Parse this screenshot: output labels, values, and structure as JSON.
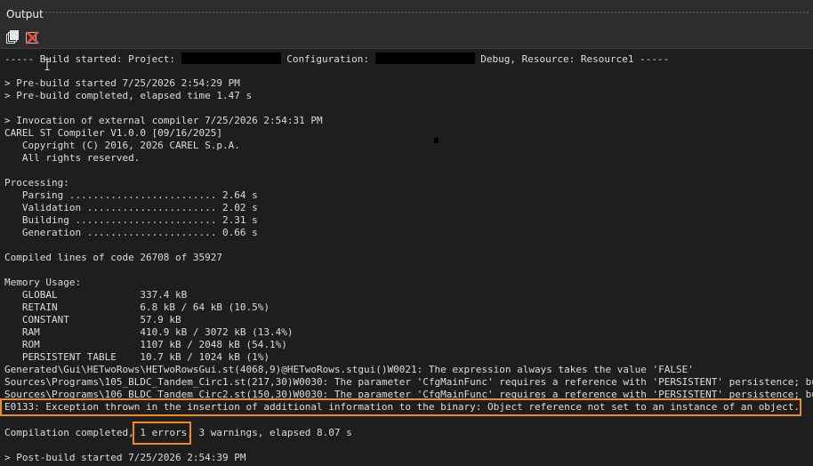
{
  "window": {
    "title": "Output"
  },
  "toolbar": {
    "buttons": [
      {
        "icon": "copy-icon",
        "tooltip": ""
      },
      {
        "icon": "clear-icon",
        "tooltip": ""
      }
    ]
  },
  "output": {
    "header_start": "----- Build started: Project: ",
    "header_config": " Configuration: ",
    "header_end": " Debug, Resource: Resource1 -----",
    "lines": [
      "> Pre-build started 7/25/2026 2:54:29 PM",
      "> Pre-build completed, elapsed time 1.47 s",
      "> Invocation of external compiler 7/25/2026 2:54:31 PM",
      "CAREL ST Compiler V1.0.0 [09/16/2025]",
      "   Copyright (C) 2016, 2026 CAREL S.p.A.",
      "   All rights reserved.",
      "Processing:",
      "   Parsing ......................... 2.64 s",
      "   Validation ...................... 2.02 s",
      "   Building ........................ 2.31 s",
      "   Generation ...................... 0.66 s",
      "Compiled lines of code 26708 of 35927",
      "Memory Usage:",
      "   GLOBAL              337.4 kB",
      "   RETAIN              6.8 kB / 64 kB (10.5%)",
      "   CONSTANT            57.9 kB",
      "   RAM                 410.9 kB / 3072 kB (13.4%)",
      "   ROM                 1107 kB / 2048 kB (54.1%)",
      "   PERSISTENT TABLE    10.7 kB / 1024 kB (1%)",
      "Generated\\Gui\\HETwoRows\\HETwoRowsGui.st(4068,9)@HETwoRows.stgui()W0021: The expression always takes the value 'FALSE'",
      "Sources\\Programs\\105_BLDC_Tandem_Circ1.st(217,30)W0030: The parameter 'CfgMainFunc' requires a reference with 'PERSISTENT' persistence; bu",
      "Sources\\Programs\\106_BLDC_Tandem_Circ2.st(150,30)W0030: The parameter 'CfgMainFunc' requires a reference with 'PERSISTENT' persistence; bu",
      "E0133: Exception thrown in the insertion of additional information to the binary: Object reference not set to an instance of an object.",
      "> Post-build started 7/25/2026 2:54:39 PM"
    ],
    "summary_start": "Compilation completed, ",
    "summary_errors": "1 errors,",
    "summary_end": " 3 warnings, elapsed 8.07 s"
  },
  "colors": {
    "background": "#1e1e1e",
    "text": "#dcdcdc",
    "highlight": "#f08a24",
    "clear_icon": "#e8503a"
  }
}
